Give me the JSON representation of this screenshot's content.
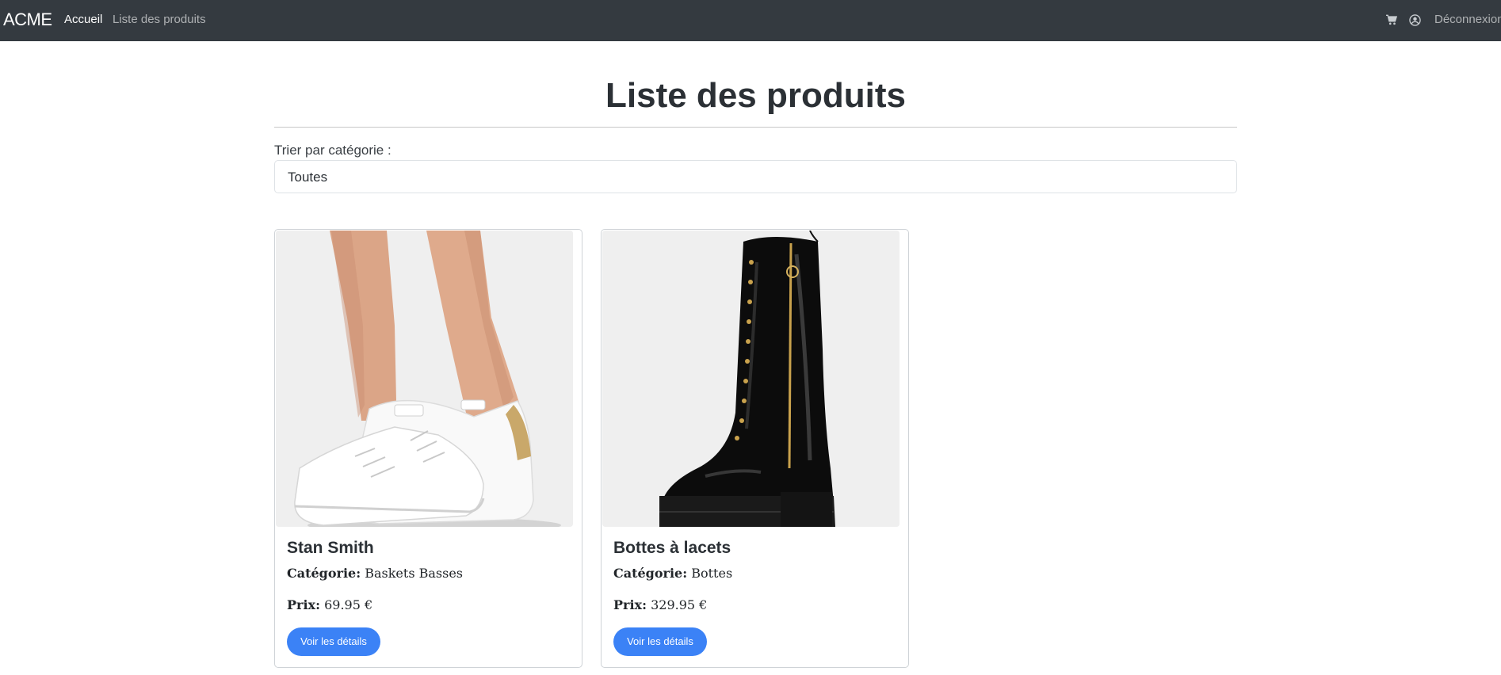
{
  "navbar": {
    "brand": "ACME",
    "links": [
      {
        "label": "Accueil",
        "active": true
      },
      {
        "label": "Liste des produits",
        "active": false
      }
    ],
    "cart_icon": "cart-icon",
    "user_icon": "user-circle-icon",
    "logout_label": "Déconnexion"
  },
  "page": {
    "title": "Liste des produits",
    "filter": {
      "label": "Trier par catégorie :",
      "selected": "Toutes"
    }
  },
  "products": [
    {
      "name": "Stan Smith",
      "category_label": "Catégorie:",
      "category": "Baskets Basses",
      "price_label": "Prix:",
      "price": "69.95 €",
      "button_label": "Voir les détails",
      "image": "white-sneakers-image"
    },
    {
      "name": "Bottes à lacets",
      "category_label": "Catégorie:",
      "category": "Bottes",
      "price_label": "Prix:",
      "price": "329.95 €",
      "button_label": "Voir les détails",
      "image": "black-lace-up-boot-image"
    }
  ],
  "colors": {
    "navbar_bg": "#343a40",
    "button_bg": "#3b82f6",
    "card_border": "#cfd3d7"
  }
}
